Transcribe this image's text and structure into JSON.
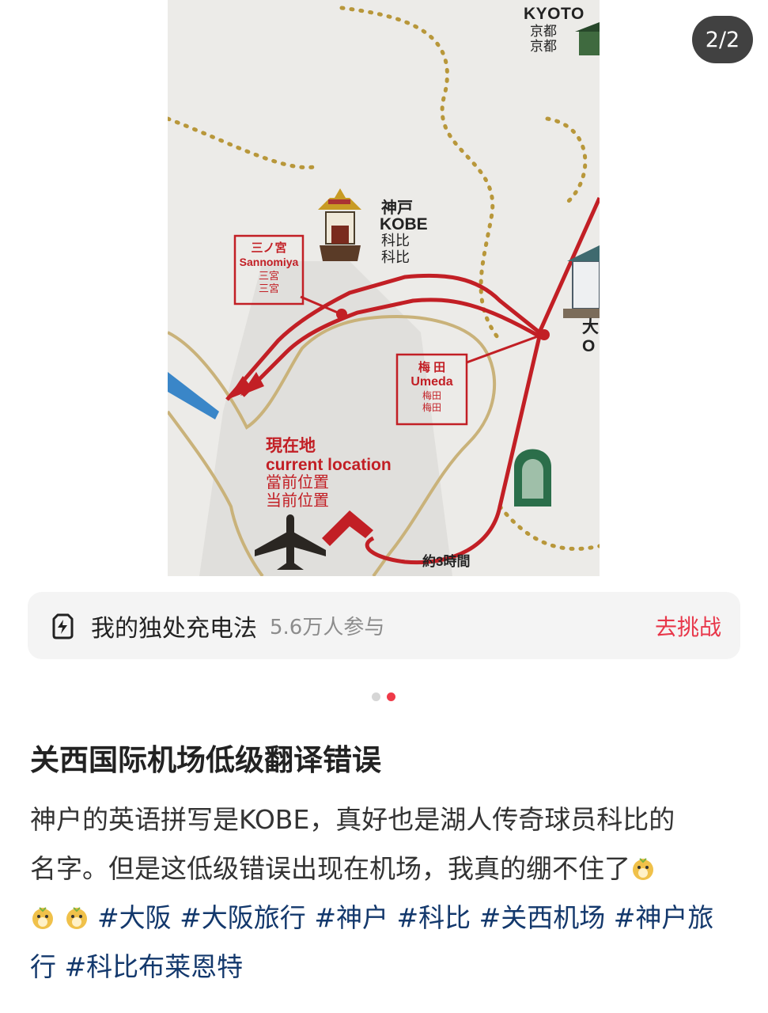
{
  "photo": {
    "counter": "2/2",
    "map": {
      "kyoto_en": "KYOTO",
      "kyoto_ja": "京都",
      "kyoto_zh": "京都",
      "kobe_kanji": "神戸",
      "kobe_en": "KOBE",
      "kobe_zh1": "科比",
      "kobe_zh2": "科比",
      "sannomiya_kanji": "三ノ宮",
      "sannomiya_en": "Sannomiya",
      "sannomiya_zh1": "三宮",
      "sannomiya_zh2": "三宮",
      "umeda_kanji": "梅 田",
      "umeda_en": "Umeda",
      "umeda_zh1": "梅田",
      "umeda_zh2": "梅田",
      "current_ja": "現在地",
      "current_en": "current location",
      "current_zh1": "當前位置",
      "current_zh2": "当前位置",
      "osaka_partial": "大",
      "osaka_partial_en": "O",
      "duration": "約3時間"
    }
  },
  "challenge": {
    "title": "我的独处充电法",
    "participants": "5.6万人参与",
    "action": "去挑战",
    "icon": "battery-charge-icon"
  },
  "pagination": {
    "total": 2,
    "active_index": 1
  },
  "post": {
    "title": "关西国际机场低级翻译错误",
    "body_line1": "神户的英语拼写是KOBE，真好也是湖人传奇球员科比的",
    "body_line2": "名字。但是这低级错误出现在机场，我真的绷不住了",
    "tags": [
      "#大阪",
      "#大阪旅行",
      "#神户",
      "#科比",
      "#关西机场",
      "#神户旅行",
      "#科比布莱恩特"
    ],
    "emoji": "bear-face-emoji"
  },
  "colors": {
    "accent": "#e8374a",
    "tag": "#13386c",
    "route_red": "#c21f25"
  }
}
